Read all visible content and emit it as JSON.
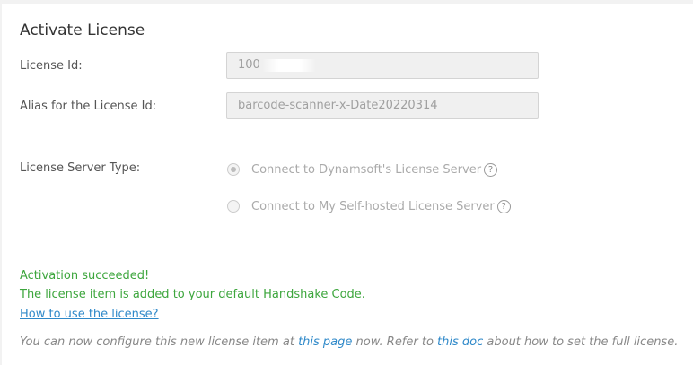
{
  "section": {
    "title": "Activate License"
  },
  "license_id": {
    "label": "License Id:",
    "value": "100"
  },
  "alias": {
    "label": "Alias for the License Id:",
    "value": "barcode-scanner-x-Date20220314"
  },
  "server_type": {
    "label": "License Server Type:",
    "options": [
      {
        "label": "Connect to Dynamsoft's License Server",
        "checked": true
      },
      {
        "label": "Connect to My Self-hosted License Server",
        "checked": false
      }
    ],
    "help_glyph": "?"
  },
  "result": {
    "status": "Activation succeeded!",
    "detail": "The license item is added to your default Handshake Code.",
    "howto_link": "How to use the license?"
  },
  "note": {
    "part1": "You can now configure this new license item at ",
    "link1": "this page",
    "part2": " now. Refer to ",
    "link2": "this doc",
    "part3": " about how to set the full license."
  },
  "colors": {
    "success": "#3da63d",
    "link": "#2f89c9"
  }
}
